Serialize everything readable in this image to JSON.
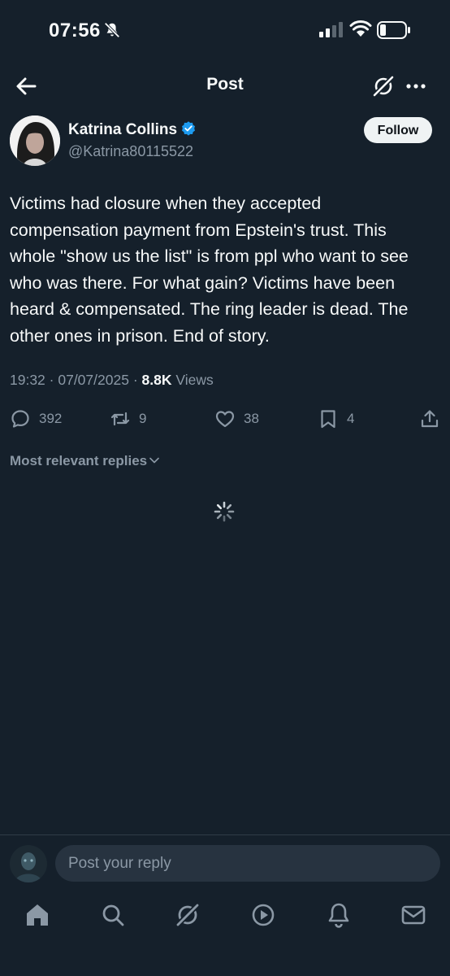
{
  "status_bar": {
    "time": "07:56",
    "icons": [
      "bell-slash-icon",
      "signal-icon",
      "wifi-icon",
      "battery-icon"
    ]
  },
  "header": {
    "title": "Post",
    "icons": [
      "back-arrow-icon",
      "grok-icon",
      "more-icon"
    ]
  },
  "post": {
    "author_name": "Katrina Collins",
    "author_handle": "@Katrina80115522",
    "follow_label": "Follow",
    "text": "Victims had closure when they accepted compensation payment from Epstein's trust. This whole \"show us the list\" is from ppl who want to see who was there. For what gain? Victims have been heard & compensated. The ring leader is dead. The other ones in prison. End of story.",
    "time": "19:32",
    "date": "07/07/2025",
    "views_count": "8.8K",
    "views_label": "Views",
    "replies": "392",
    "reposts": "9",
    "likes": "38",
    "bookmarks": "4"
  },
  "replies_section": {
    "sort_label": "Most relevant replies"
  },
  "reply_composer": {
    "placeholder": "Post your reply"
  },
  "tab_bar": {
    "tabs": [
      "home-icon",
      "search-icon",
      "grok-icon",
      "video-icon",
      "notifications-icon",
      "messages-icon"
    ]
  },
  "colors": {
    "background": "#15202b",
    "text": "#f7f9f9",
    "secondary_text": "#8b98a5",
    "verified_blue": "#1d9bf0",
    "follow_button_bg": "#eff3f4",
    "input_bg": "#273340"
  }
}
